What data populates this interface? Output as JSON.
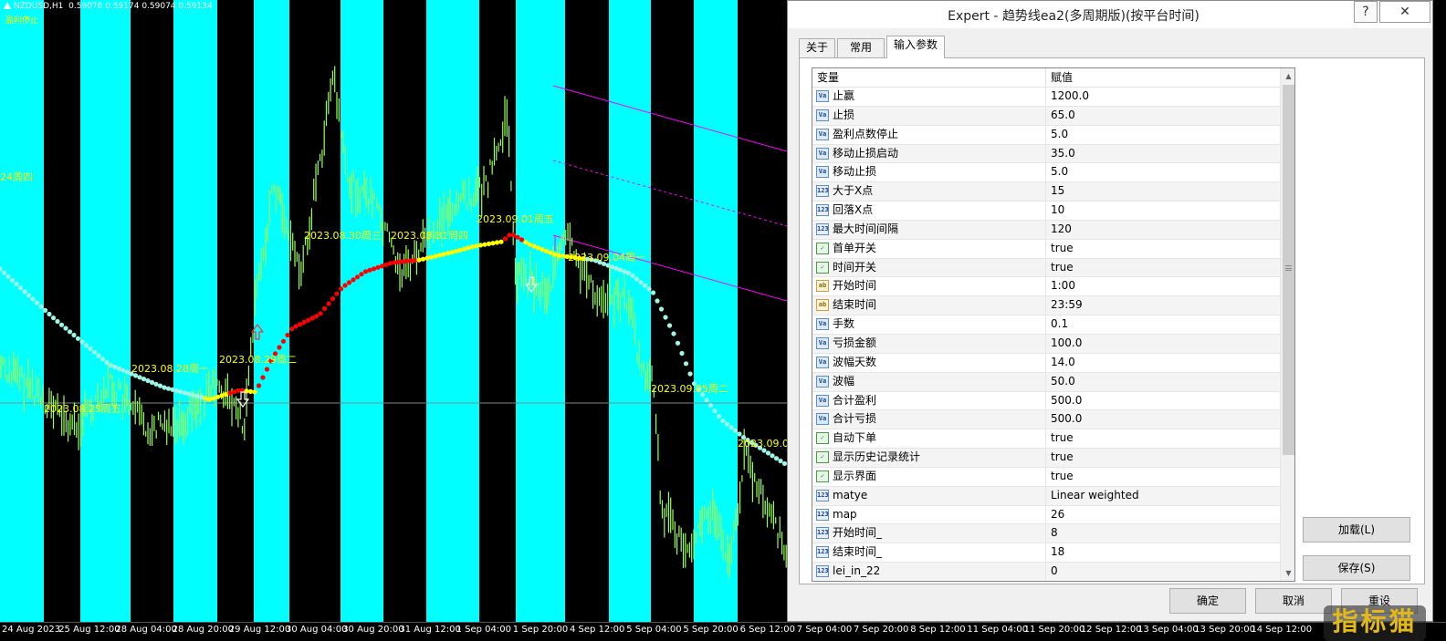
{
  "chart": {
    "symbol": "NZDUSD,H1",
    "prices": "0.59076 0.59174 0.59074 0.59134",
    "subtitle": "盈利停止",
    "day_label_left": "24周四",
    "annotations": [
      {
        "text": "2023.08.25周五"
      },
      {
        "text": "2023.08.28周一"
      },
      {
        "text": "2023.08.29周二"
      },
      {
        "text": "2023.08.30周三"
      },
      {
        "text": "2023.08.31周四"
      },
      {
        "text": "2023.09.01周五"
      },
      {
        "text": "2023.09.04周一"
      },
      {
        "text": "2023.09.05周二"
      },
      {
        "text": "2023.09.0"
      }
    ],
    "time_axis": [
      "24 Aug 2023",
      "25 Aug 12:00",
      "28 Aug 04:00",
      "28 Aug 20:00",
      "29 Aug 12:00",
      "30 Aug 04:00",
      "30 Aug 20:00",
      "31 Aug 12:00",
      "1 Sep 04:00",
      "1 Sep 20:00",
      "4 Sep 12:00",
      "5 Sep 04:00",
      "5 Sep 20:00",
      "6 Sep 12:00",
      "7 Sep 04:00",
      "7 Sep 20:00",
      "8 Sep 12:00",
      "11 Sep 04:00",
      "11 Sep 20:00",
      "12 Sep 12:00",
      "13 Sep 04:00",
      "13 Sep 20:00",
      "14 Sep 12:00"
    ],
    "colors": {
      "cyan": "#00ffff",
      "black": "#000000",
      "candle": "#9bff5a",
      "red": "#ff0000",
      "yellow": "#ffff00",
      "aqua_ma": "#9ff5e6",
      "magenta": "#ff00ff"
    }
  },
  "dialog": {
    "title": "Expert - 趋势线ea2(多周期版)(按平台时间)",
    "help_label": "?",
    "close_label": "✕",
    "tabs": [
      {
        "label": "关于",
        "active": false
      },
      {
        "label": "常用",
        "active": false
      },
      {
        "label": "输入参数",
        "active": true
      }
    ],
    "columns": {
      "variable": "变量",
      "value": "赋值"
    },
    "params": [
      {
        "type": "double",
        "icon": "Va",
        "name": "止赢",
        "value": "1200.0"
      },
      {
        "type": "double",
        "icon": "Va",
        "name": "止损",
        "value": "65.0"
      },
      {
        "type": "double",
        "icon": "Va",
        "name": "盈利点数停止",
        "value": "5.0"
      },
      {
        "type": "double",
        "icon": "Va",
        "name": "移动止损启动",
        "value": "35.0"
      },
      {
        "type": "double",
        "icon": "Va",
        "name": "移动止损",
        "value": "5.0"
      },
      {
        "type": "int",
        "icon": "123",
        "name": "大于X点",
        "value": "15"
      },
      {
        "type": "int",
        "icon": "123",
        "name": "回落X点",
        "value": "10"
      },
      {
        "type": "int",
        "icon": "123",
        "name": "最大时间间隔",
        "value": "120"
      },
      {
        "type": "bool",
        "icon": "✓",
        "name": "首单开关",
        "value": "true"
      },
      {
        "type": "bool",
        "icon": "✓",
        "name": "时间开关",
        "value": "true"
      },
      {
        "type": "string",
        "icon": "ab",
        "name": "开始时间",
        "value": "1:00"
      },
      {
        "type": "string",
        "icon": "ab",
        "name": "结束时间",
        "value": "23:59"
      },
      {
        "type": "double",
        "icon": "Va",
        "name": "手数",
        "value": "0.1"
      },
      {
        "type": "double",
        "icon": "Va",
        "name": "亏损金额",
        "value": "100.0"
      },
      {
        "type": "double",
        "icon": "Va",
        "name": "波幅天数",
        "value": "14.0"
      },
      {
        "type": "double",
        "icon": "Va",
        "name": "波幅",
        "value": "50.0"
      },
      {
        "type": "double",
        "icon": "Va",
        "name": "合计盈利",
        "value": "500.0"
      },
      {
        "type": "double",
        "icon": "Va",
        "name": "合计亏损",
        "value": "500.0"
      },
      {
        "type": "bool",
        "icon": "✓",
        "name": "自动下单",
        "value": "true"
      },
      {
        "type": "bool",
        "icon": "✓",
        "name": "显示历史记录统计",
        "value": "true"
      },
      {
        "type": "bool",
        "icon": "✓",
        "name": "显示界面",
        "value": "true"
      },
      {
        "type": "enum",
        "icon": "123",
        "name": "matye",
        "value": "Linear weighted"
      },
      {
        "type": "int",
        "icon": "123",
        "name": "map",
        "value": "26"
      },
      {
        "type": "int",
        "icon": "123",
        "name": "开始时间_",
        "value": "8"
      },
      {
        "type": "int",
        "icon": "123",
        "name": "结束时间_",
        "value": "18"
      },
      {
        "type": "int",
        "icon": "123",
        "name": "lei_in_22",
        "value": "0"
      }
    ],
    "buttons": {
      "load": "加载(L)",
      "save": "保存(S)",
      "ok": "确定",
      "cancel": "取消",
      "reset": "重设"
    }
  },
  "watermark": "指标猫"
}
